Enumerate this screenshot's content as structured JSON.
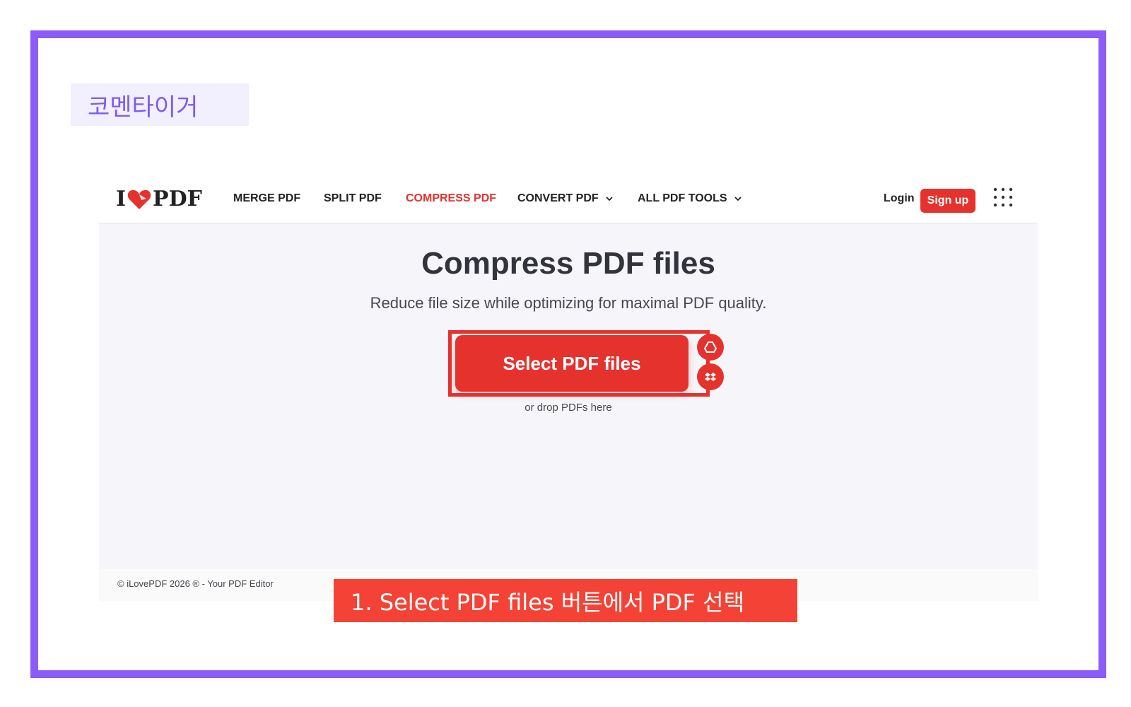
{
  "badge": {
    "text": "코멘타이거"
  },
  "logo": {
    "left_text": "I",
    "right_text": "PDF"
  },
  "nav": {
    "items": [
      {
        "label": "MERGE PDF"
      },
      {
        "label": "SPLIT PDF"
      },
      {
        "label": "COMPRESS PDF"
      },
      {
        "label": "CONVERT PDF"
      },
      {
        "label": "ALL PDF TOOLS"
      }
    ],
    "login": "Login",
    "signup": "Sign up"
  },
  "hero": {
    "title": "Compress PDF files",
    "subtitle": "Reduce file size while optimizing for maximal PDF quality.",
    "select_button": "Select PDF files",
    "drop_text": "or drop PDFs here"
  },
  "footer": {
    "text": "© iLovePDF 2026 ® - Your PDF Editor"
  },
  "caption": {
    "text": "1. Select PDF files 버튼에서 PDF 선택"
  },
  "icons": {
    "heart": "heart-icon",
    "grid": "grid-menu-icon",
    "chevron": "chevron-down-icon",
    "google_drive": "google-drive-icon",
    "dropbox": "dropbox-icon"
  },
  "colors": {
    "brand": "#e5322d",
    "frame": "#8b5cf6",
    "badge_text": "#7c5cf2",
    "caption_bg": "#f44336"
  }
}
